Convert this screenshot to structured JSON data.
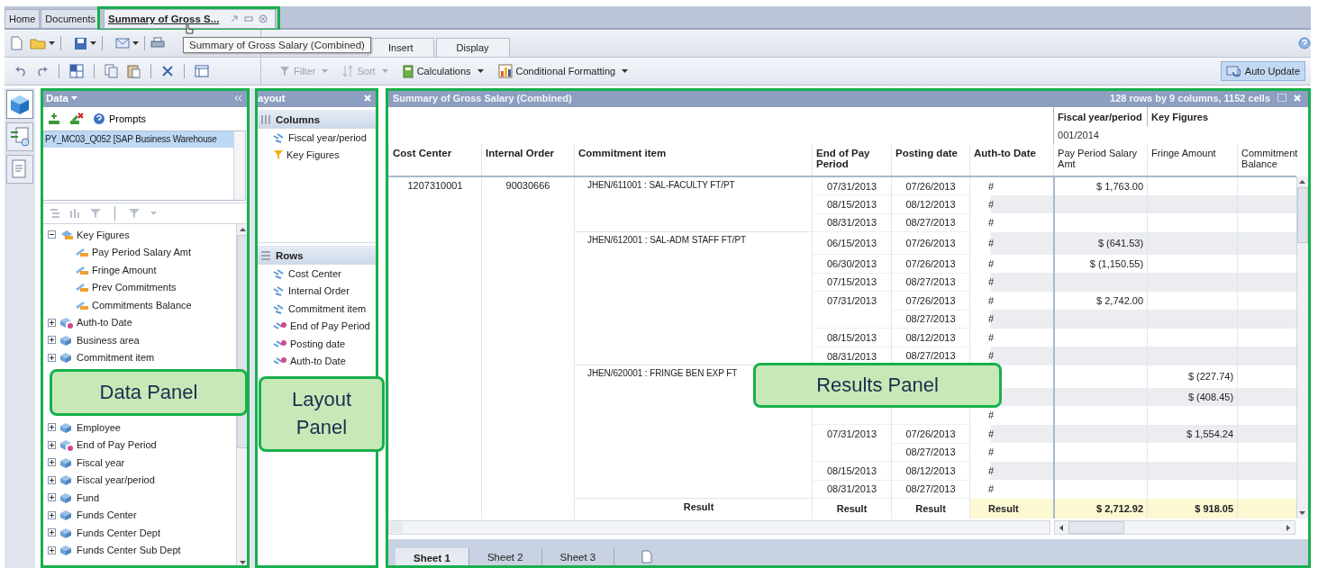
{
  "document_tabs": [
    {
      "label": "Home",
      "selected": false
    },
    {
      "label": "Documents",
      "selected": false
    },
    {
      "label": "Summary of Gross S...",
      "selected": true
    }
  ],
  "tooltip": "Summary of Gross Salary (Combined)",
  "ribbon_tabs": [
    {
      "label": "Insert",
      "selected": false
    },
    {
      "label": "Display",
      "selected": false
    }
  ],
  "toolbar": {
    "items": [
      {
        "label": "Filter",
        "disabled": true
      },
      {
        "label": "Sort",
        "disabled": true
      },
      {
        "label": "Calculations",
        "disabled": false
      },
      {
        "label": "Conditional Formatting",
        "disabled": false
      }
    ],
    "auto_update": {
      "label": "Auto Update",
      "on": true
    }
  },
  "side_tabs": [
    {
      "kind": "cube",
      "selected": true
    },
    {
      "kind": "swap",
      "selected": false
    },
    {
      "kind": "document",
      "selected": false
    }
  ],
  "data_panel": {
    "title": "Data",
    "prompts": "Prompts",
    "sources": [
      {
        "label": "PY_MC03_Q052 [SAP Business Warehouse",
        "selected": true
      }
    ],
    "tree": [
      {
        "label": "Key Figures",
        "kind": "measures",
        "expanded": true,
        "children": [
          {
            "label": "Pay Period Salary Amt",
            "kind": "measure"
          },
          {
            "label": "Fringe Amount",
            "kind": "measure"
          },
          {
            "label": "Prev Commitments",
            "kind": "measure"
          },
          {
            "label": "Commitments Balance",
            "kind": "measure"
          }
        ]
      },
      {
        "label": "Auth-to Date",
        "kind": "date",
        "expanded": false
      },
      {
        "label": "Business area",
        "kind": "dimension",
        "expanded": false
      },
      {
        "label": "Commitment item",
        "kind": "dimension",
        "expanded": false
      },
      {
        "label": "Employee",
        "kind": "dimension",
        "expanded": false,
        "gap_before": true
      },
      {
        "label": "End of Pay Period",
        "kind": "date",
        "expanded": false
      },
      {
        "label": "Fiscal year",
        "kind": "dimension",
        "expanded": false
      },
      {
        "label": "Fiscal year/period",
        "kind": "dimension",
        "expanded": false
      },
      {
        "label": "Fund",
        "kind": "dimension",
        "expanded": false
      },
      {
        "label": "Funds Center",
        "kind": "dimension",
        "expanded": false
      },
      {
        "label": "Funds Center Dept",
        "kind": "dimension",
        "expanded": false
      },
      {
        "label": "Funds Center Sub Dept",
        "kind": "dimension",
        "expanded": false
      }
    ]
  },
  "layout_panel": {
    "title": "ayout",
    "sections": [
      {
        "title": "Columns",
        "kind": "columns",
        "items": [
          {
            "label": "Fiscal year/period",
            "kind": "dimension"
          },
          {
            "label": "Key Figures",
            "kind": "filter"
          }
        ]
      },
      {
        "title": "Rows",
        "kind": "rows",
        "items": [
          {
            "label": "Cost Center",
            "kind": "dimension"
          },
          {
            "label": "Internal Order",
            "kind": "dimension"
          },
          {
            "label": "Commitment item",
            "kind": "dimension"
          },
          {
            "label": "End of Pay Period",
            "kind": "date"
          },
          {
            "label": "Posting date",
            "kind": "date"
          },
          {
            "label": "Auth-to Date",
            "kind": "date"
          }
        ]
      }
    ]
  },
  "results_panel": {
    "title": "Summary of Gross Salary (Combined)",
    "summary": "128 rows by 9 columns, 1152 cells",
    "column_groups": [
      {
        "label": "Fiscal year/period",
        "member": "001/2014"
      },
      {
        "label": "Key Figures"
      }
    ],
    "columns": [
      "Cost Center",
      "Internal Order",
      "Commitment item",
      "End of Pay Period",
      "Posting date",
      "Auth-to Date",
      "Pay Period Salary Amt",
      "Fringe Amount",
      "Commitment Balance"
    ],
    "rows": [
      {
        "cost_center": "1207310001",
        "internal_order": "90030666",
        "groups": [
          {
            "commitment_item": "JHEN/611001 : SAL-FACULTY FT/PT",
            "lines": [
              {
                "end_of_pay": "07/31/2013",
                "posting": "07/26/2013",
                "auth": "#",
                "salary": "$ 1,763.00"
              },
              {
                "end_of_pay": "08/15/2013",
                "posting": "08/12/2013",
                "auth": "#"
              },
              {
                "end_of_pay": "08/31/2013",
                "posting": "08/27/2013",
                "auth": "#"
              }
            ]
          },
          {
            "commitment_item": "JHEN/612001 : SAL-ADM STAFF FT/PT",
            "lines": [
              {
                "end_of_pay": "06/15/2013",
                "posting": "07/26/2013",
                "auth": "#",
                "salary": "$ (641.53)"
              },
              {
                "end_of_pay": "06/30/2013",
                "posting": "07/26/2013",
                "auth": "#",
                "salary": "$ (1,150.55)"
              },
              {
                "end_of_pay": "07/15/2013",
                "posting": "08/27/2013",
                "auth": "#"
              },
              {
                "end_of_pay": "07/31/2013",
                "posting": "07/26/2013",
                "auth": "#",
                "salary": "$ 2,742.00"
              },
              {
                "posting": "08/27/2013",
                "auth": "#"
              },
              {
                "end_of_pay": "08/15/2013",
                "posting": "08/12/2013",
                "auth": "#"
              },
              {
                "end_of_pay": "08/31/2013",
                "posting": "08/27/2013",
                "auth": "#"
              }
            ]
          },
          {
            "commitment_item": "JHEN/620001 : FRINGE BEN EXP FT",
            "lines": [
              {
                "fringe": "$ (227.74)"
              },
              {
                "fringe": "$ (408.45)"
              },
              {
                "auth": "#"
              },
              {
                "end_of_pay": "07/31/2013",
                "posting": "07/26/2013",
                "auth": "#",
                "fringe": "$ 1,554.24"
              },
              {
                "posting": "08/27/2013",
                "auth": "#"
              },
              {
                "end_of_pay": "08/15/2013",
                "posting": "08/12/2013",
                "auth": "#"
              },
              {
                "end_of_pay": "08/31/2013",
                "posting": "08/27/2013",
                "auth": "#"
              }
            ]
          }
        ]
      }
    ],
    "result": {
      "commitment_item": "Result",
      "end_of_pay": "Result",
      "posting": "Result",
      "auth": "Result",
      "salary": "$ 2,712.92",
      "fringe": "$ 918.05"
    }
  },
  "sheet_tabs": [
    {
      "label": "Sheet 1",
      "selected": true
    },
    {
      "label": "Sheet 2",
      "selected": false
    },
    {
      "label": "Sheet 3",
      "selected": false
    }
  ],
  "callouts": [
    {
      "label": "Data Panel"
    },
    {
      "label": "Layout Panel"
    },
    {
      "label": "Results Panel"
    }
  ]
}
